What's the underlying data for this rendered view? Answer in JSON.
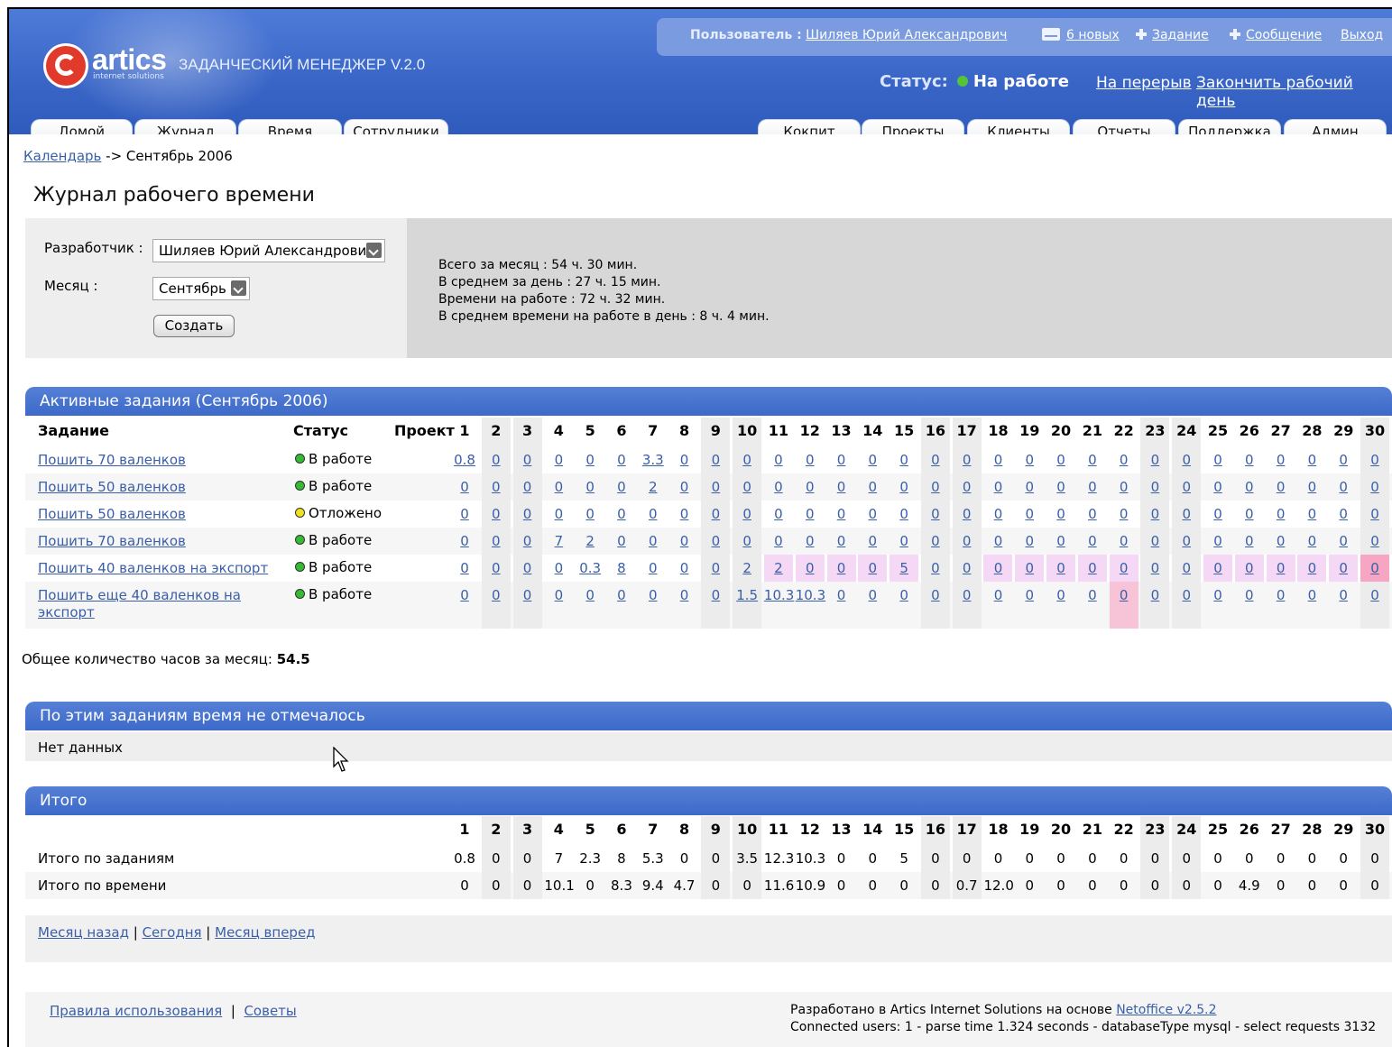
{
  "header": {
    "logo_text": "artics",
    "logo_sub": "internet solutions",
    "app_title": "ЗАДАНЧЕСКИЙ МЕНЕДЖЕР V.2.0",
    "user_label": "Пользователь :",
    "user_name": "Шиляев Юрий Александрович",
    "messages_link": "6 новых",
    "task_link": "Задание",
    "message_link": "Сообщение",
    "logout_link": "Выход",
    "status_label": "Статус:",
    "status_value": "На работе",
    "break_link": "На перерыв",
    "end_day_link": "Закончить рабочий день"
  },
  "tabs_left": [
    "Домой",
    "Журнал",
    "Время",
    "Сотрудники"
  ],
  "tabs_right": [
    "Кокпит",
    "Проекты",
    "Клиенты",
    "Отчеты",
    "Поддержка",
    "Админ"
  ],
  "breadcrumb": {
    "link": "Календарь",
    "current": " -> Сентябрь 2006"
  },
  "page_title": "Журнал рабочего времени",
  "filter": {
    "developer_label": "Разработчик :",
    "developer_value": "Шиляев Юрий Александрович",
    "month_label": "Месяц :",
    "month_value": "Сентябрь",
    "create_button": "Создать"
  },
  "stats": {
    "line1": "Всего за месяц : 54 ч. 30 мин.",
    "line2": "В среднем за день : 27 ч. 15 мин.",
    "line3": "Времени на работе : 72 ч. 32 мин.",
    "line4": "В среднем времени на работе в день : 8 ч. 4 мин."
  },
  "active": {
    "title": "Активные задания (Сентябрь 2006)",
    "col_task": "Задание",
    "col_status": "Статус",
    "col_project": "Проект",
    "days": [
      "1",
      "2",
      "3",
      "4",
      "5",
      "6",
      "7",
      "8",
      "9",
      "10",
      "11",
      "12",
      "13",
      "14",
      "15",
      "16",
      "17",
      "18",
      "19",
      "20",
      "21",
      "22",
      "23",
      "24",
      "25",
      "26",
      "27",
      "28",
      "29",
      "30"
    ],
    "rows": [
      {
        "task": "Пошить 70 валенков",
        "status": "В работе",
        "status_color": "#33bb33",
        "values": [
          "0.8",
          "0",
          "0",
          "0",
          "0",
          "0",
          "3.3",
          "0",
          "0",
          "0",
          "0",
          "0",
          "0",
          "0",
          "0",
          "0",
          "0",
          "0",
          "0",
          "0",
          "0",
          "0",
          "0",
          "0",
          "0",
          "0",
          "0",
          "0",
          "0",
          "0"
        ]
      },
      {
        "task": "Пошить 50 валенков",
        "status": "В работе",
        "status_color": "#33bb33",
        "values": [
          "0",
          "0",
          "0",
          "0",
          "0",
          "0",
          "2",
          "0",
          "0",
          "0",
          "0",
          "0",
          "0",
          "0",
          "0",
          "0",
          "0",
          "0",
          "0",
          "0",
          "0",
          "0",
          "0",
          "0",
          "0",
          "0",
          "0",
          "0",
          "0",
          "0"
        ]
      },
      {
        "task": "Пошить 50 валенков",
        "status": "Отложено",
        "status_color": "#f0e020",
        "values": [
          "0",
          "0",
          "0",
          "0",
          "0",
          "0",
          "0",
          "0",
          "0",
          "0",
          "0",
          "0",
          "0",
          "0",
          "0",
          "0",
          "0",
          "0",
          "0",
          "0",
          "0",
          "0",
          "0",
          "0",
          "0",
          "0",
          "0",
          "0",
          "0",
          "0"
        ]
      },
      {
        "task": "Пошить 70 валенков",
        "status": "В работе",
        "status_color": "#33bb33",
        "values": [
          "0",
          "0",
          "0",
          "7",
          "2",
          "0",
          "0",
          "0",
          "0",
          "0",
          "0",
          "0",
          "0",
          "0",
          "0",
          "0",
          "0",
          "0",
          "0",
          "0",
          "0",
          "0",
          "0",
          "0",
          "0",
          "0",
          "0",
          "0",
          "0",
          "0"
        ]
      },
      {
        "task": "Пошить 40 валенков на экспорт",
        "status": "В работе",
        "status_color": "#33bb33",
        "values": [
          "0",
          "0",
          "0",
          "0",
          "0.3",
          "8",
          "0",
          "0",
          "0",
          "2",
          "2",
          "0",
          "0",
          "0",
          "5",
          "0",
          "0",
          "0",
          "0",
          "0",
          "0",
          "0",
          "0",
          "0",
          "0",
          "0",
          "0",
          "0",
          "0",
          "0"
        ]
      },
      {
        "task": "Пошить еще 40 валенков на экспорт",
        "status": "В работе",
        "status_color": "#33bb33",
        "values": [
          "0",
          "0",
          "0",
          "0",
          "0",
          "0",
          "0",
          "0",
          "0",
          "1.5",
          "10.3",
          "10.3",
          "0",
          "0",
          "0",
          "0",
          "0",
          "0",
          "0",
          "0",
          "0",
          "0",
          "0",
          "0",
          "0",
          "0",
          "0",
          "0",
          "0",
          "0"
        ]
      }
    ]
  },
  "total_month": {
    "label": "Общее количество часов за месяц:",
    "value": "54.5"
  },
  "no_time": {
    "title": "По этим заданиям время не отмечалось",
    "text": "Нет данных"
  },
  "totals": {
    "title": "Итого",
    "row_tasks_label": "Итого по заданиям",
    "row_tasks": [
      "0.8",
      "0",
      "0",
      "7",
      "2.3",
      "8",
      "5.3",
      "0",
      "0",
      "3.5",
      "12.3",
      "10.3",
      "0",
      "0",
      "5",
      "0",
      "0",
      "0",
      "0",
      "0",
      "0",
      "0",
      "0",
      "0",
      "0",
      "0",
      "0",
      "0",
      "0",
      "0"
    ],
    "row_time_label": "Итого по времени",
    "row_time": [
      "0",
      "0",
      "0",
      "10.1",
      "0",
      "8.3",
      "9.4",
      "4.7",
      "0",
      "0",
      "11.6",
      "10.9",
      "0",
      "0",
      "0",
      "0",
      "0.7",
      "12.0",
      "0",
      "0",
      "0",
      "0",
      "0",
      "0",
      "0",
      "4.9",
      "0",
      "0",
      "0",
      "0"
    ]
  },
  "nav": {
    "prev": "Месяц назад",
    "today": "Сегодня",
    "next": "Месяц вперед"
  },
  "footer": {
    "rules": "Правила использования",
    "tips": "Советы",
    "credit": "Разработано в Artics Internet Solutions на основе ",
    "credit_link": "Netoffice v2.5.2",
    "stats": "Connected users: 1 -  parse time 1.324 seconds - databaseType mysql - select requests 3132"
  },
  "colors": {
    "header_blue": "#3a66c8",
    "pink_weekend": "#f5d8f5",
    "pink_today": "#f7c3d6",
    "link": "#3a5fa8"
  }
}
